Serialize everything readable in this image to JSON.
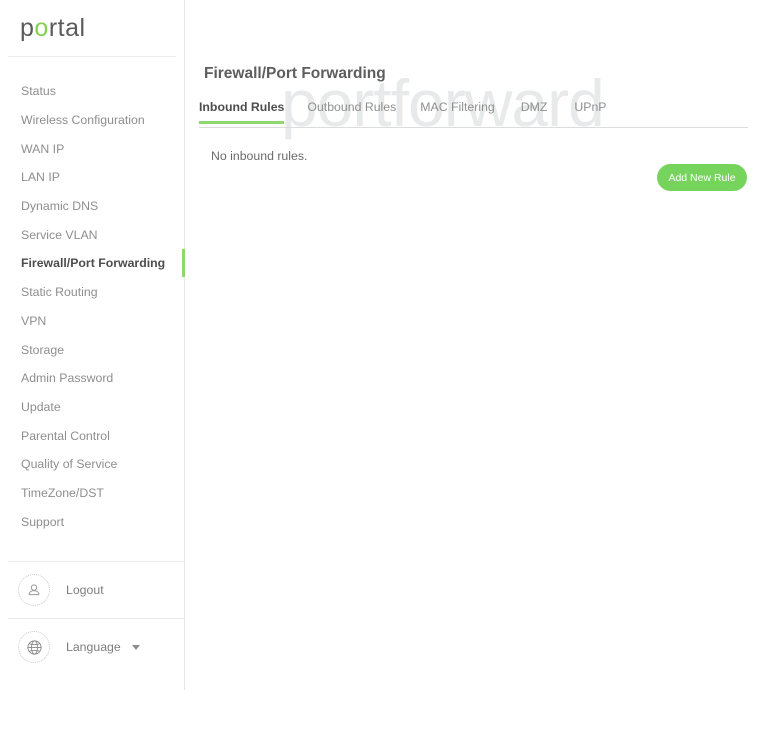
{
  "brand": {
    "name_prefix": "p",
    "name_accent": "o",
    "name_suffix": "rtal",
    "accent_color": "#7fd14f"
  },
  "sidebar": {
    "items": [
      {
        "label": "Status",
        "active": false
      },
      {
        "label": "Wireless Configuration",
        "active": false
      },
      {
        "label": "WAN IP",
        "active": false
      },
      {
        "label": "LAN IP",
        "active": false
      },
      {
        "label": "Dynamic DNS",
        "active": false
      },
      {
        "label": "Service VLAN",
        "active": false
      },
      {
        "label": "Firewall/Port Forwarding",
        "active": true
      },
      {
        "label": "Static Routing",
        "active": false
      },
      {
        "label": "VPN",
        "active": false
      },
      {
        "label": "Storage",
        "active": false
      },
      {
        "label": "Admin Password",
        "active": false
      },
      {
        "label": "Update",
        "active": false
      },
      {
        "label": "Parental Control",
        "active": false
      },
      {
        "label": "Quality of Service",
        "active": false
      },
      {
        "label": "TimeZone/DST",
        "active": false
      },
      {
        "label": "Support",
        "active": false
      }
    ],
    "footer": {
      "logout_label": "Logout",
      "logout_icon": "user-icon",
      "language_label": "Language",
      "language_icon": "globe-icon",
      "language_caret_icon": "chevron-down-icon"
    },
    "active_indicator_color": "#8bd96f"
  },
  "main": {
    "page_title": "Firewall/Port Forwarding",
    "watermark": "portforward",
    "tabs": [
      {
        "label": "Inbound Rules",
        "active": true
      },
      {
        "label": "Outbound Rules",
        "active": false
      },
      {
        "label": "MAC Filtering",
        "active": false
      },
      {
        "label": "DMZ",
        "active": false
      },
      {
        "label": "UPnP",
        "active": false
      }
    ],
    "empty_message": "No inbound rules.",
    "add_rule_label": "Add New Rule",
    "add_rule_color": "#76d45c",
    "tab_underline_color": "#8bd96f"
  }
}
